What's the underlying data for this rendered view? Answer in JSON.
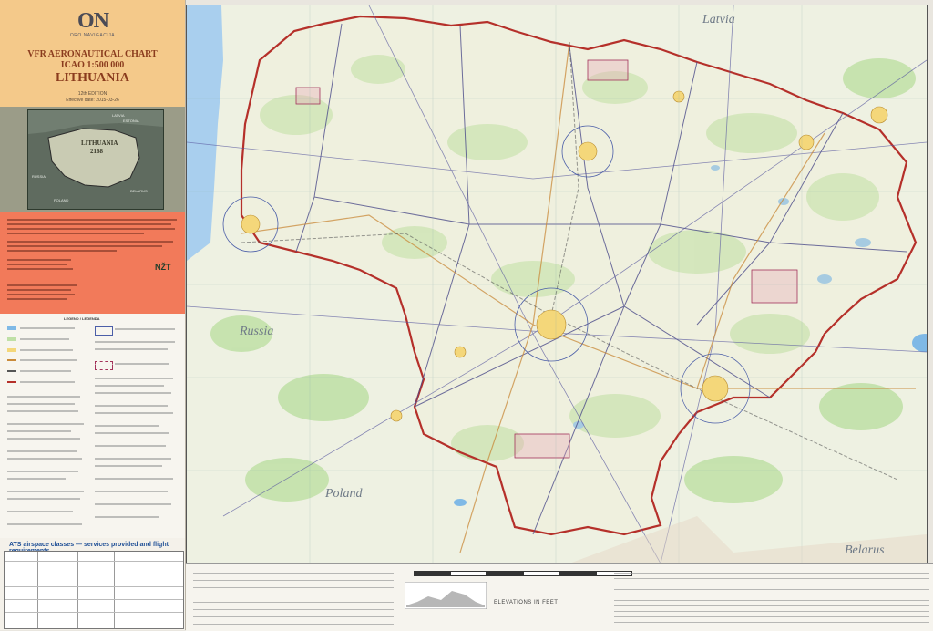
{
  "cover": {
    "logo_text": "ON",
    "logo_sub": "ORO NAVIGACIJA",
    "chart_type": "VFR AERONAUTICAL CHART",
    "chart_scale": "ICAO 1:500 000",
    "country": "LITHUANIA",
    "edition": "12th EDITION",
    "effective": "Effective date: 2015-03-26"
  },
  "index_map": {
    "sheet_name": "LITHUANIA",
    "sheet_number": "2168",
    "labels": [
      "LATVIA",
      "ESTONIA",
      "RUSSIA",
      "BELARUS",
      "POLAND"
    ]
  },
  "info_panel": {
    "logo": "NŽT"
  },
  "legend": {
    "heading": "LEGEND / LEGENDA"
  },
  "ats": {
    "title": "ATS airspace classes — services provided and flight requirements"
  },
  "map": {
    "country_labels": [
      {
        "key": "latvia",
        "text": "Latvia"
      },
      {
        "key": "russia",
        "text": "Russia"
      },
      {
        "key": "poland",
        "text": "Poland"
      },
      {
        "key": "belarus",
        "text": "Belarus"
      }
    ]
  },
  "bottom": {
    "elevation_label": "ELEVATIONS IN FEET"
  },
  "colors": {
    "cover": "#f4c98a",
    "info": "#f27a5a",
    "index_grey": "#9b9c88",
    "border_red": "#b5302a",
    "forest": "#bfe0a6",
    "water": "#7fb9e6",
    "airway": "#5a5aa0"
  }
}
